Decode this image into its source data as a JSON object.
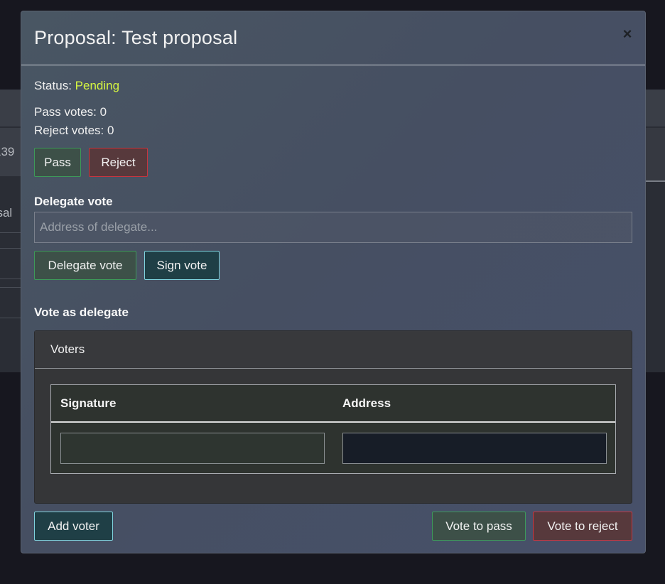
{
  "background": {
    "left_cell_text": "139",
    "left_cell_text2": "osal"
  },
  "modal": {
    "title": "Proposal: Test proposal",
    "close_symbol": "×",
    "status_label": "Status:",
    "status_value": "Pending",
    "pass_votes": "Pass votes: 0",
    "reject_votes": "Reject votes: 0",
    "pass_button": "Pass",
    "reject_button": "Reject",
    "delegate_section_label": "Delegate vote",
    "delegate_placeholder": "Address of delegate...",
    "delegate_button": "Delegate vote",
    "sign_button": "Sign vote",
    "vote_as_delegate_label": "Vote as delegate",
    "voters_card": {
      "header": "Voters",
      "columns": [
        "Signature",
        "Address"
      ]
    },
    "add_voter_button": "Add voter",
    "vote_pass_button": "Vote to pass",
    "vote_reject_button": "Vote to reject"
  },
  "colors": {
    "status_pending": "#d5f542",
    "success_border": "#3d9a59",
    "danger_border": "#c8353f",
    "info_border": "#7fd3de"
  },
  "icons": {
    "close": "close-icon"
  }
}
